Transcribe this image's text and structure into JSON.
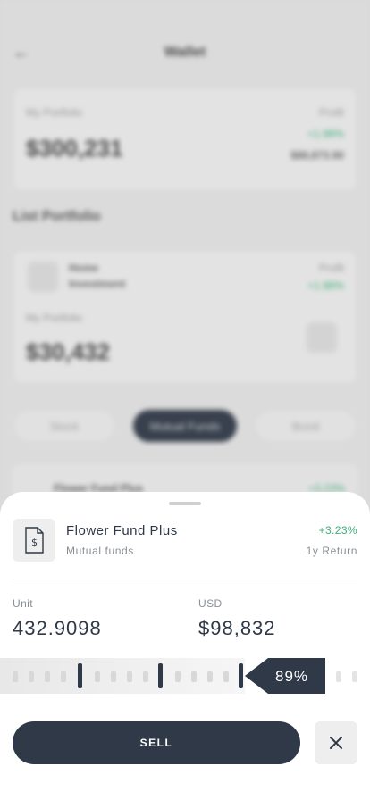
{
  "background": {
    "header_title": "Wallet",
    "card1": {
      "label": "My Portfolio",
      "value": "$300,231",
      "right_label": "Profit",
      "right_green": "+1.98%",
      "right_value": "$88,873.90"
    },
    "section_title": "List Portfolio",
    "card2": {
      "name_line1": "Home",
      "name_line2": "Investment",
      "right_label": "Profit",
      "right_green": "+1.98%",
      "label": "My Portfolio",
      "value": "$30,432"
    },
    "chips": [
      "Stock",
      "Mutual Funds",
      "Bond"
    ],
    "list_item": {
      "name": "Flower Fund Plus",
      "return": "+3.23%"
    }
  },
  "sheet": {
    "fund_name": "Flower Fund Plus",
    "fund_type": "Mutual funds",
    "return_value": "+3.23%",
    "return_label": "1y Return",
    "unit_label": "Unit",
    "unit_value": "432.9098",
    "usd_label": "USD",
    "usd_value": "$98,832",
    "slider_percent_label": "89%",
    "slider_value": 0.89,
    "sell_label": "SELL"
  },
  "colors": {
    "primary": "#2f3947",
    "positive": "#3bb27a",
    "muted": "#8a8f96"
  },
  "icons": {
    "fund": "dollar-document-icon",
    "close": "close-icon",
    "back": "back-arrow-icon"
  }
}
